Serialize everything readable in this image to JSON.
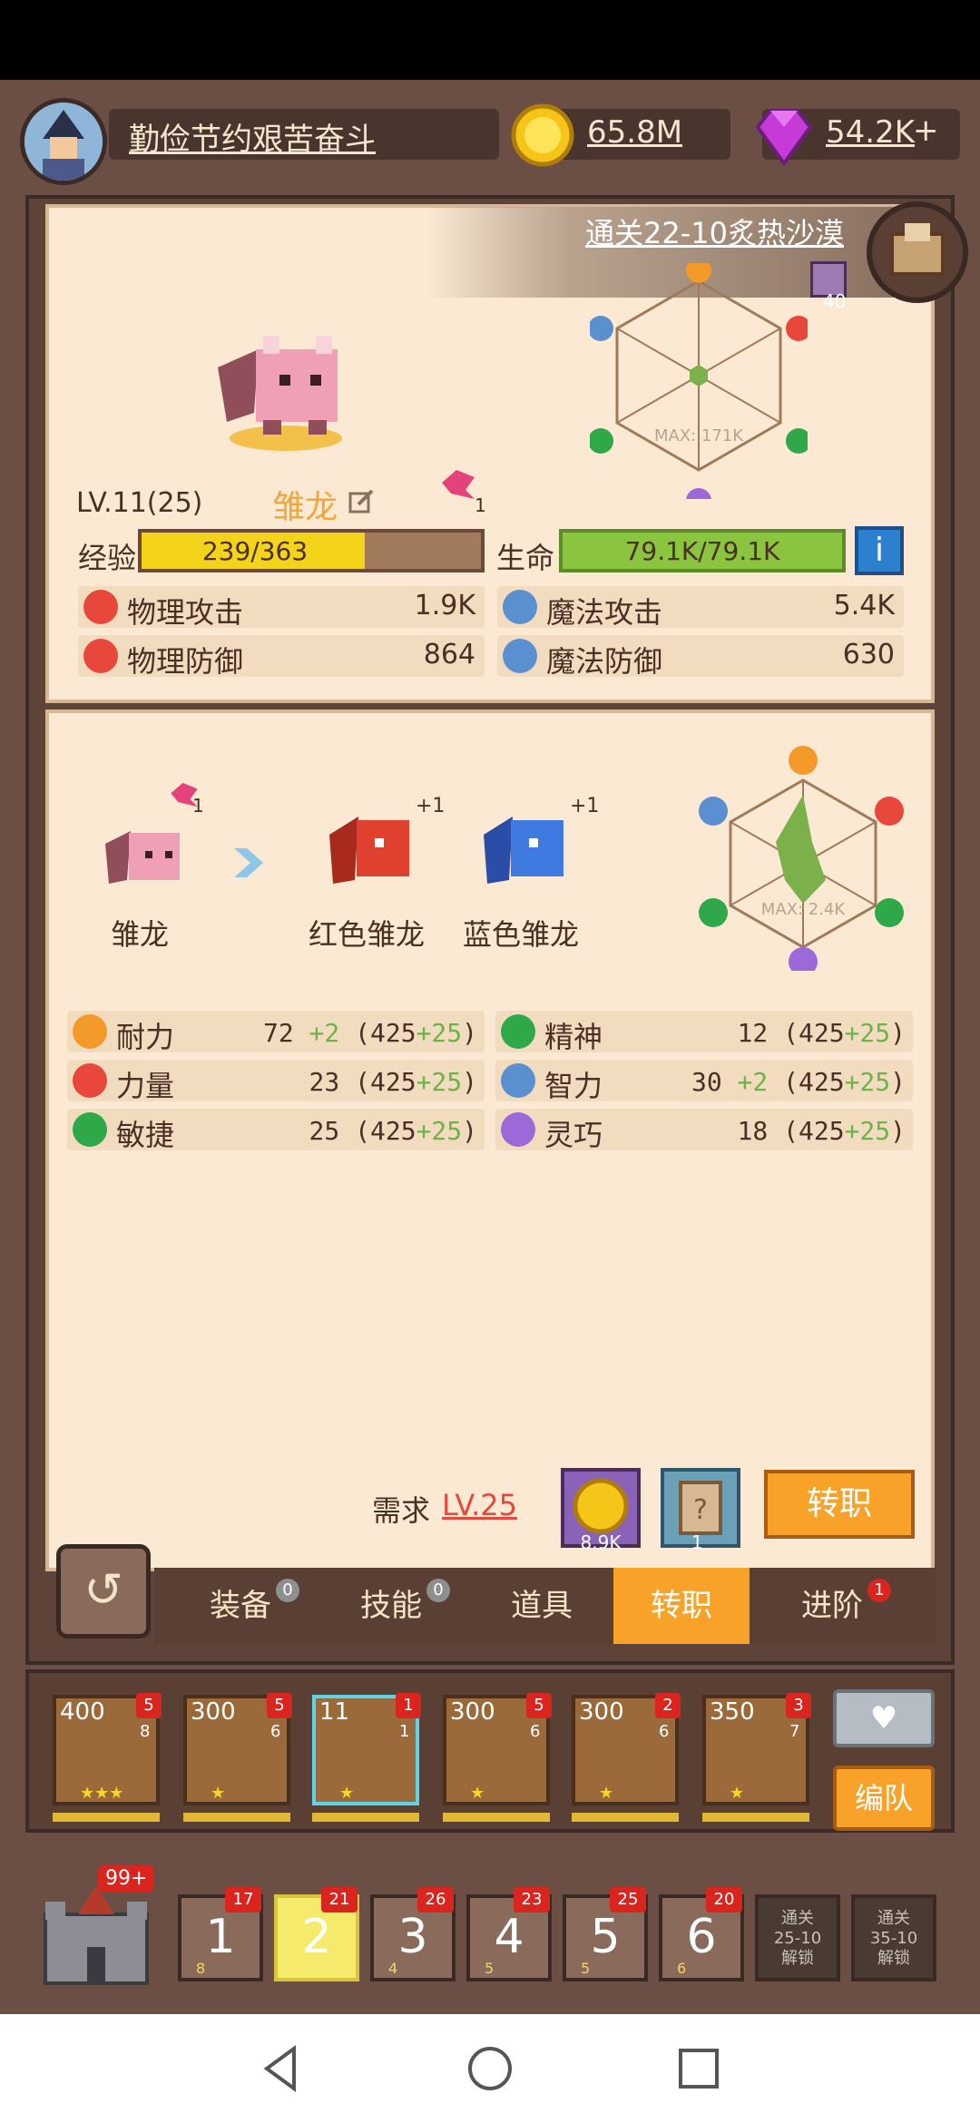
{
  "header": {
    "player_name": "勤俭节约艰苦奋斗",
    "gold": "65.8M",
    "gems": "54.2K",
    "gem_plus": "+"
  },
  "stage_banner": {
    "text": "通关22-10炙热沙漠",
    "sword_count": "40"
  },
  "pet": {
    "level": "LV.11(25)",
    "name": "雏龙",
    "token_count": "1",
    "exp_label": "经验",
    "exp_text": "239/363",
    "exp_progress": 0.658,
    "hp_label": "生命",
    "hp_text": "79.1K/79.1K",
    "info_label": "i",
    "radar_max": "MAX: 171K",
    "stats": [
      {
        "label": "物理攻击",
        "value": "1.9K",
        "icon": "sword-icon",
        "color": "#e8473c"
      },
      {
        "label": "魔法攻击",
        "value": "5.4K",
        "icon": "magic-icon",
        "color": "#5a8fd0"
      },
      {
        "label": "物理防御",
        "value": "864",
        "icon": "shield-icon",
        "color": "#e8473c"
      },
      {
        "label": "魔法防御",
        "value": "630",
        "icon": "crystal-icon",
        "color": "#5a8fd0"
      }
    ]
  },
  "evolution": {
    "from": "雏龙",
    "from_count": "1",
    "to": [
      {
        "name": "红色雏龙",
        "bonus": "+1"
      },
      {
        "name": "蓝色雏龙",
        "bonus": "+1"
      }
    ],
    "radar_max": "MAX: 2.4K",
    "attributes": [
      {
        "label": "耐力",
        "base": "72",
        "plus": "+2",
        "cap": "425",
        "cap_plus": "+25",
        "icon": "endurance-icon",
        "color": "#f39a2a"
      },
      {
        "label": "精神",
        "base": "12",
        "plus": "",
        "cap": "425",
        "cap_plus": "+25",
        "icon": "spirit-icon",
        "color": "#2fa84a"
      },
      {
        "label": "力量",
        "base": "23",
        "plus": "",
        "cap": "425",
        "cap_plus": "+25",
        "icon": "strength-icon",
        "color": "#e8473c"
      },
      {
        "label": "智力",
        "base": "30",
        "plus": "+2",
        "cap": "425",
        "cap_plus": "+25",
        "icon": "intellect-icon",
        "color": "#5a8fd0"
      },
      {
        "label": "敏捷",
        "base": "25",
        "plus": "",
        "cap": "425",
        "cap_plus": "+25",
        "icon": "agility-icon",
        "color": "#2fa84a"
      },
      {
        "label": "灵巧",
        "base": "18",
        "plus": "",
        "cap": "425",
        "cap_plus": "+25",
        "icon": "dexterity-icon",
        "color": "#9b6ad8"
      }
    ],
    "requirement_label": "需求",
    "requirement_level": "LV.25",
    "cost_gold": "8.9K",
    "cost_scroll": "1",
    "change_button": "转职"
  },
  "tabs": [
    {
      "label": "装备",
      "badge": "0",
      "badge_color": "grey"
    },
    {
      "label": "技能",
      "badge": "0",
      "badge_color": "grey"
    },
    {
      "label": "道具",
      "badge": "",
      "badge_color": ""
    },
    {
      "label": "转职",
      "badge": "",
      "badge_color": "",
      "active": true
    },
    {
      "label": "进阶",
      "badge": "1",
      "badge_color": "red"
    }
  ],
  "team": [
    {
      "num": "400",
      "badge": "5",
      "sub": "8",
      "stars": "★★★"
    },
    {
      "num": "300",
      "badge": "5",
      "sub": "6",
      "stars": "★"
    },
    {
      "num": "11",
      "badge": "1",
      "sub": "1",
      "stars": "★",
      "selected": true
    },
    {
      "num": "300",
      "badge": "5",
      "sub": "6",
      "stars": "★"
    },
    {
      "num": "300",
      "badge": "2",
      "sub": "6",
      "stars": "★"
    },
    {
      "num": "350",
      "badge": "3",
      "sub": "7",
      "stars": "★"
    }
  ],
  "team_buttons": {
    "heart": "♥",
    "formation": "编队"
  },
  "castle_badge": "99+",
  "stages": [
    {
      "num": "1",
      "badge": "17",
      "sub": "8"
    },
    {
      "num": "2",
      "badge": "21",
      "sub": "",
      "active": true
    },
    {
      "num": "3",
      "badge": "26",
      "sub": "4"
    },
    {
      "num": "4",
      "badge": "23",
      "sub": "5"
    },
    {
      "num": "5",
      "badge": "25",
      "sub": "5"
    },
    {
      "num": "6",
      "badge": "20",
      "sub": "6"
    }
  ],
  "locked_stages": [
    {
      "line1": "通关",
      "line2": "25-10",
      "line3": "解锁"
    },
    {
      "line1": "通关",
      "line2": "35-10",
      "line3": "解锁"
    }
  ]
}
